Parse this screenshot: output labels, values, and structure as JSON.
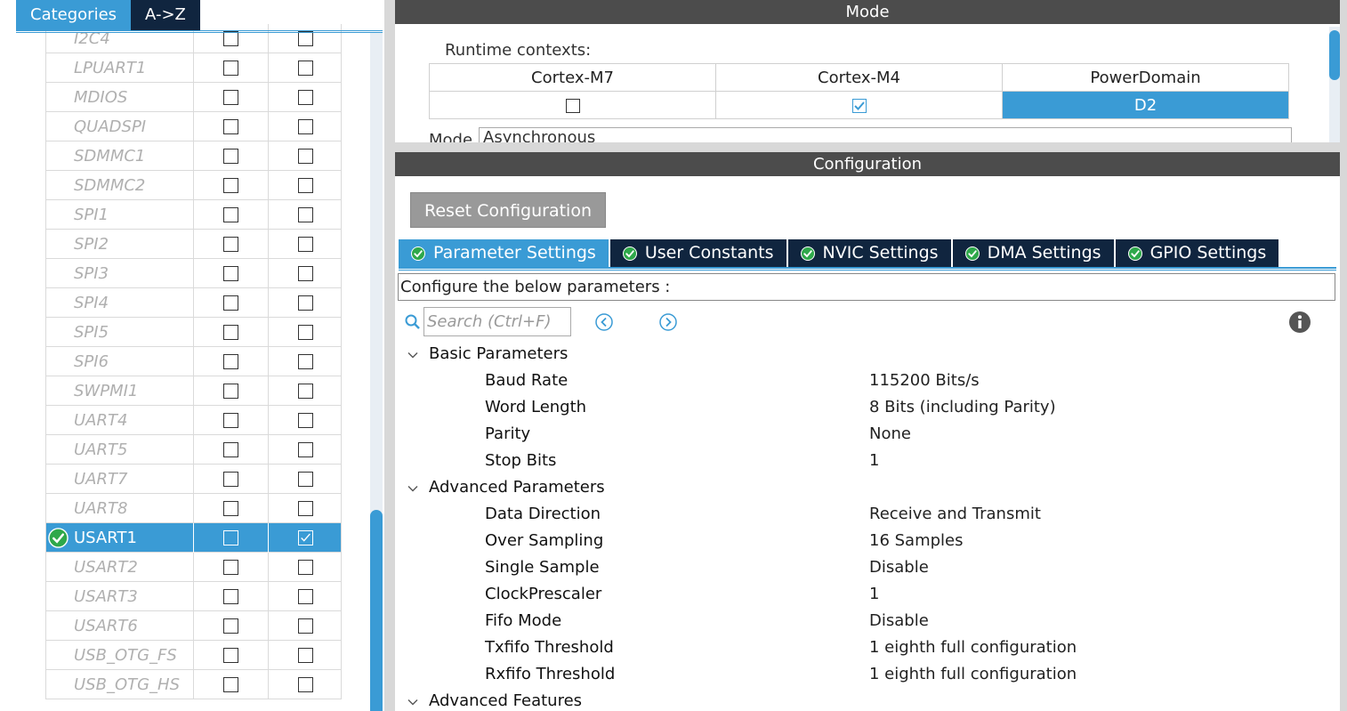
{
  "left": {
    "tabs": [
      {
        "label": "Categories",
        "active": true
      },
      {
        "label": "A->Z",
        "active": false
      }
    ],
    "peripherals": [
      {
        "name": "I2C4",
        "enabled": false,
        "col1": false,
        "col2": false
      },
      {
        "name": "LPUART1",
        "enabled": false,
        "col1": false,
        "col2": false
      },
      {
        "name": "MDIOS",
        "enabled": false,
        "col1": false,
        "col2": false
      },
      {
        "name": "QUADSPI",
        "enabled": false,
        "col1": false,
        "col2": false
      },
      {
        "name": "SDMMC1",
        "enabled": false,
        "col1": false,
        "col2": false
      },
      {
        "name": "SDMMC2",
        "enabled": false,
        "col1": false,
        "col2": false
      },
      {
        "name": "SPI1",
        "enabled": false,
        "col1": false,
        "col2": false
      },
      {
        "name": "SPI2",
        "enabled": false,
        "col1": false,
        "col2": false
      },
      {
        "name": "SPI3",
        "enabled": false,
        "col1": false,
        "col2": false
      },
      {
        "name": "SPI4",
        "enabled": false,
        "col1": false,
        "col2": false
      },
      {
        "name": "SPI5",
        "enabled": false,
        "col1": false,
        "col2": false
      },
      {
        "name": "SPI6",
        "enabled": false,
        "col1": false,
        "col2": false
      },
      {
        "name": "SWPMI1",
        "enabled": false,
        "col1": false,
        "col2": false
      },
      {
        "name": "UART4",
        "enabled": false,
        "col1": false,
        "col2": false
      },
      {
        "name": "UART5",
        "enabled": false,
        "col1": false,
        "col2": false
      },
      {
        "name": "UART7",
        "enabled": false,
        "col1": false,
        "col2": false
      },
      {
        "name": "UART8",
        "enabled": false,
        "col1": false,
        "col2": false
      },
      {
        "name": "USART1",
        "enabled": true,
        "col1": false,
        "col2": true
      },
      {
        "name": "USART2",
        "enabled": false,
        "col1": false,
        "col2": false
      },
      {
        "name": "USART3",
        "enabled": false,
        "col1": false,
        "col2": false
      },
      {
        "name": "USART6",
        "enabled": false,
        "col1": false,
        "col2": false
      },
      {
        "name": "USB_OTG_FS",
        "enabled": false,
        "col1": false,
        "col2": false
      },
      {
        "name": "USB_OTG_HS",
        "enabled": false,
        "col1": false,
        "col2": false
      }
    ]
  },
  "mode": {
    "header": "Mode",
    "runtime_label": "Runtime contexts:",
    "contexts": [
      {
        "label": "Cortex-M7",
        "checked": false
      },
      {
        "label": "Cortex-M4",
        "checked": true
      },
      {
        "label": "PowerDomain",
        "value": "D2"
      }
    ],
    "mode_label": "Mode",
    "mode_value": "Asynchronous"
  },
  "config": {
    "header": "Configuration",
    "reset_label": "Reset Configuration",
    "tabs": [
      {
        "label": "Parameter Settings",
        "active": true
      },
      {
        "label": "User Constants",
        "active": false
      },
      {
        "label": "NVIC Settings",
        "active": false
      },
      {
        "label": "DMA Settings",
        "active": false
      },
      {
        "label": "GPIO Settings",
        "active": false
      }
    ],
    "description": "Configure the below parameters :",
    "search_placeholder": "Search (Ctrl+F)",
    "groups": [
      {
        "label": "Basic Parameters",
        "params": [
          {
            "name": "Baud Rate",
            "value": "115200 Bits/s"
          },
          {
            "name": "Word Length",
            "value": "8 Bits (including Parity)"
          },
          {
            "name": "Parity",
            "value": "None"
          },
          {
            "name": "Stop Bits",
            "value": "1"
          }
        ]
      },
      {
        "label": "Advanced Parameters",
        "params": [
          {
            "name": "Data Direction",
            "value": "Receive and Transmit"
          },
          {
            "name": "Over Sampling",
            "value": "16 Samples"
          },
          {
            "name": "Single Sample",
            "value": "Disable"
          },
          {
            "name": "ClockPrescaler",
            "value": "1"
          },
          {
            "name": "Fifo Mode",
            "value": "Disable"
          },
          {
            "name": "Txfifo Threshold",
            "value": "1 eighth full configuration"
          },
          {
            "name": "Rxfifo Threshold",
            "value": "1 eighth full configuration"
          }
        ]
      },
      {
        "label": "Advanced Features",
        "params": []
      }
    ]
  },
  "colors": {
    "accent": "#3a9bd5",
    "dark_tab": "#10253f",
    "header_bar": "#4c4c4c",
    "ok_green": "#2ea84a"
  }
}
